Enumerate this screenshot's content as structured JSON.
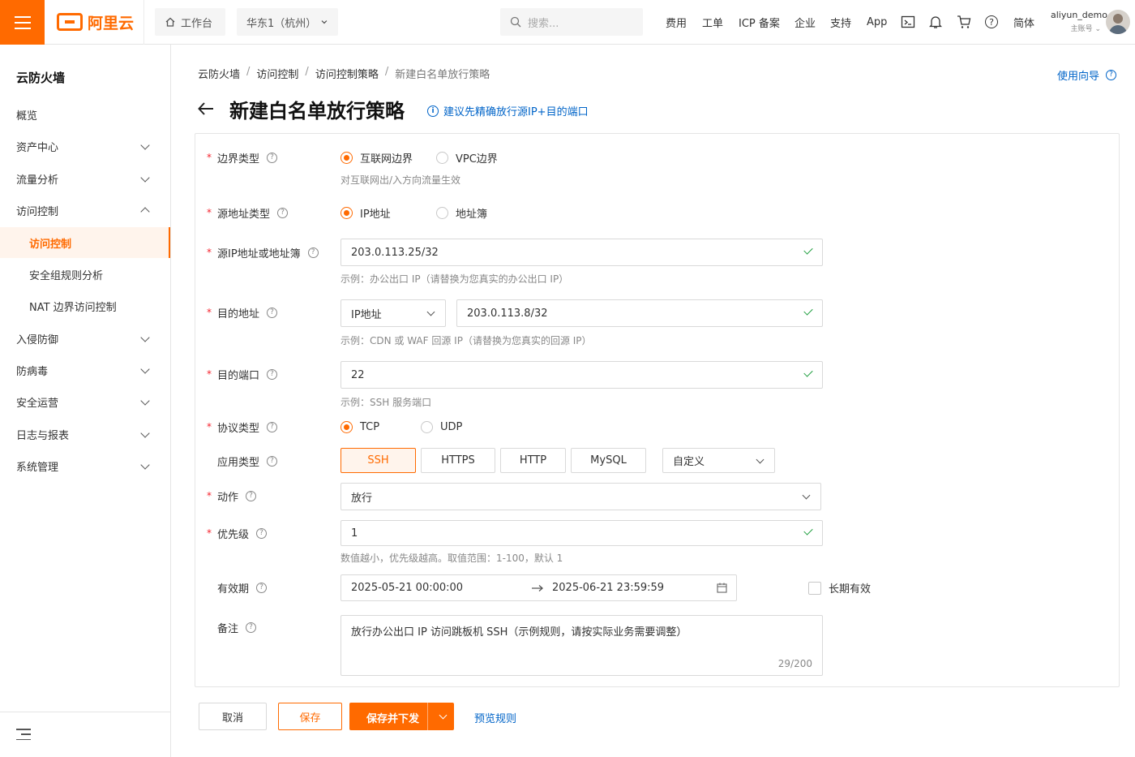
{
  "header": {
    "brand": "阿里云",
    "workbench": "工作台",
    "region": "华东1（杭州）",
    "search_placeholder": "搜索...",
    "nav": [
      "费用",
      "工单",
      "ICP 备案",
      "企业",
      "支持",
      "App"
    ],
    "language": "简体",
    "user_name": "aliyun_demo",
    "user_role": "主账号"
  },
  "sidebar": {
    "title": "云防火墙",
    "items": [
      {
        "label": "概览"
      },
      {
        "label": "资产中心"
      },
      {
        "label": "流量分析"
      },
      {
        "label": "访问控制"
      },
      {
        "label": "访问控制"
      },
      {
        "label": "安全组规则分析"
      },
      {
        "label": "NAT 边界访问控制"
      },
      {
        "label": "入侵防御"
      },
      {
        "label": "防病毒"
      },
      {
        "label": "安全运营"
      },
      {
        "label": "日志与报表"
      },
      {
        "label": "系统管理"
      }
    ]
  },
  "breadcrumb": [
    "云防火墙",
    "访问控制",
    "访问控制策略",
    "新建白名单放行策略"
  ],
  "breadcrumb_sep": "/",
  "guide_link": "使用向导",
  "page_title": "新建白名单放行策略",
  "tip": "建议先精确放行源IP+目的端口",
  "form": {
    "boundary": {
      "label": "边界类型",
      "options": [
        "互联网边界",
        "VPC边界"
      ],
      "selected": "互联网边界",
      "hint": "对互联网出/入方向流量生效"
    },
    "source_type": {
      "label": "源地址类型",
      "options": [
        "IP地址",
        "地址簿"
      ],
      "selected": "IP地址"
    },
    "source_ip": {
      "label": "源IP地址或地址簿",
      "value": "203.0.113.25/32",
      "hint": "示例：办公出口 IP（请替换为您真实的办公出口 IP）"
    },
    "dest": {
      "label": "目的地址",
      "type_value": "IP地址",
      "value": "203.0.113.8/32",
      "hint": "示例：CDN 或 WAF 回源 IP（请替换为您真实的回源 IP）"
    },
    "dest_port": {
      "label": "目的端口",
      "value": "22",
      "hint": "示例：SSH 服务端口"
    },
    "protocol": {
      "label": "协议类型",
      "options": [
        "TCP",
        "UDP"
      ],
      "selected": "TCP"
    },
    "app_type": {
      "label": "应用类型",
      "options": [
        "SSH",
        "HTTPS",
        "HTTP",
        "MySQL"
      ],
      "selected": "SSH",
      "custom": "自定义"
    },
    "action": {
      "label": "动作",
      "value": "放行"
    },
    "priority": {
      "label": "优先级",
      "value": "1",
      "hint": "数值越小，优先级越高。取值范围：1-100，默认 1"
    },
    "validity": {
      "label": "有效期",
      "start": "2025-05-21 00:00:00",
      "end": "2025-06-21 23:59:59",
      "long_term_label": "长期有效",
      "long_term": false
    },
    "remark": {
      "label": "备注",
      "value": "放行办公出口 IP 访问跳板机 SSH（示例规则，请按实际业务需要调整）",
      "count": "29/200"
    }
  },
  "footer": {
    "cancel": "取消",
    "save": "保存",
    "save_deploy": "保存并下发",
    "preview": "预览规则"
  },
  "colors": {
    "accent": "#ff6a00",
    "link": "#0064c8",
    "success": "#1e9e3e",
    "required": "#f5222d"
  }
}
